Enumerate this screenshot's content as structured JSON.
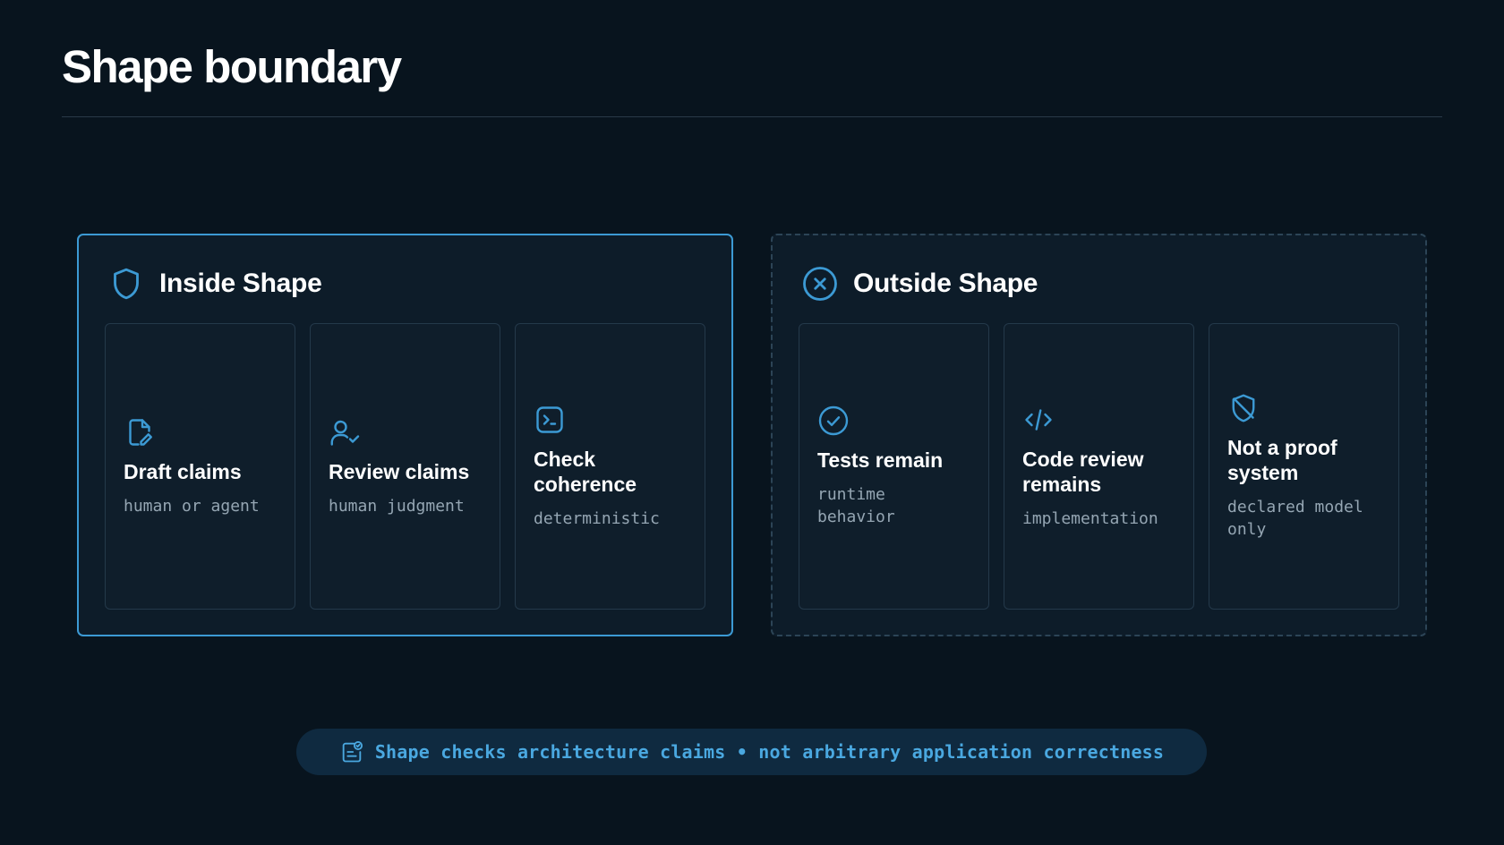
{
  "page": {
    "title": "Shape boundary"
  },
  "colors": {
    "accent": "#3c9ad4",
    "background": "#08141e",
    "panel": "#0d1c29",
    "muted_text": "#95a6b3"
  },
  "inside": {
    "title": "Inside Shape",
    "icon": "shield-icon",
    "cards": [
      {
        "title": "Draft claims",
        "subtitle": "human or agent",
        "icon": "file-edit-icon"
      },
      {
        "title": "Review claims",
        "subtitle": "human judgment",
        "icon": "user-check-icon"
      },
      {
        "title": "Check coherence",
        "subtitle": "deterministic",
        "icon": "terminal-icon"
      }
    ]
  },
  "outside": {
    "title": "Outside Shape",
    "icon": "x-circle-icon",
    "cards": [
      {
        "title": "Tests remain",
        "subtitle": "runtime behavior",
        "icon": "check-circle-icon"
      },
      {
        "title": "Code review remains",
        "subtitle": "implementation",
        "icon": "code-icon"
      },
      {
        "title": "Not a proof system",
        "subtitle": "declared model only",
        "icon": "shield-off-icon"
      }
    ]
  },
  "footer": {
    "text": "Shape checks architecture claims • not arbitrary application correctness",
    "icon": "clipboard-check-icon"
  }
}
